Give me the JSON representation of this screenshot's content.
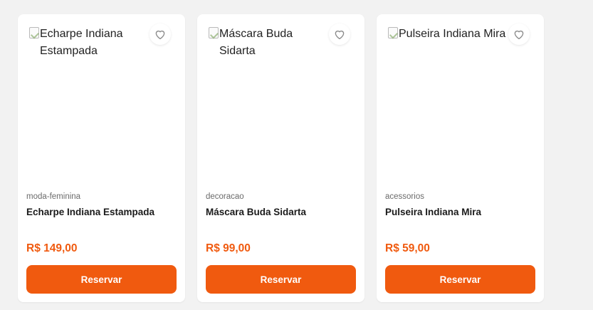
{
  "colors": {
    "accent": "#f05a0f",
    "background": "#f2f2f2",
    "card": "#ffffff"
  },
  "products": [
    {
      "image_alt": "Echarpe Indiana Estampada",
      "category": "moda-feminina",
      "name": "Echarpe Indiana Estampada",
      "price": "R$ 149,00",
      "button_label": "Reservar",
      "favorite_icon": "heart-outline-icon"
    },
    {
      "image_alt": "Máscara Buda Sidarta",
      "category": "decoracao",
      "name": "Máscara Buda Sidarta",
      "price": "R$ 99,00",
      "button_label": "Reservar",
      "favorite_icon": "heart-outline-icon"
    },
    {
      "image_alt": "Pulseira Indiana Mira",
      "category": "acessorios",
      "name": "Pulseira Indiana Mira",
      "price": "R$ 59,00",
      "button_label": "Reservar",
      "favorite_icon": "heart-outline-icon"
    }
  ]
}
